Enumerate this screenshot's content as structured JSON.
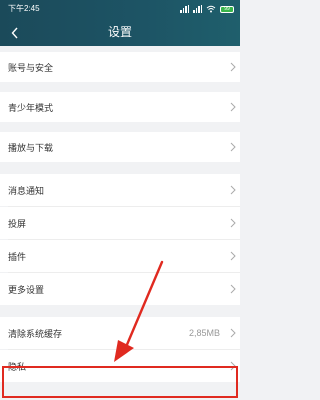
{
  "status_bar": {
    "time": "下午2:45",
    "battery_level": "99"
  },
  "header": {
    "title": "设置"
  },
  "settings": {
    "group1": [
      {
        "label": "账号与安全"
      }
    ],
    "group2": [
      {
        "label": "青少年模式"
      }
    ],
    "group3": [
      {
        "label": "播放与下载"
      }
    ],
    "group4": [
      {
        "label": "消息通知"
      },
      {
        "label": "投屏"
      },
      {
        "label": "插件"
      },
      {
        "label": "更多设置"
      }
    ],
    "group5": [
      {
        "label": "清除系统缓存",
        "value": "2,85MB"
      },
      {
        "label": "隐私"
      }
    ]
  },
  "colors": {
    "header": "#1d5465",
    "annotation": "#e02a20"
  }
}
